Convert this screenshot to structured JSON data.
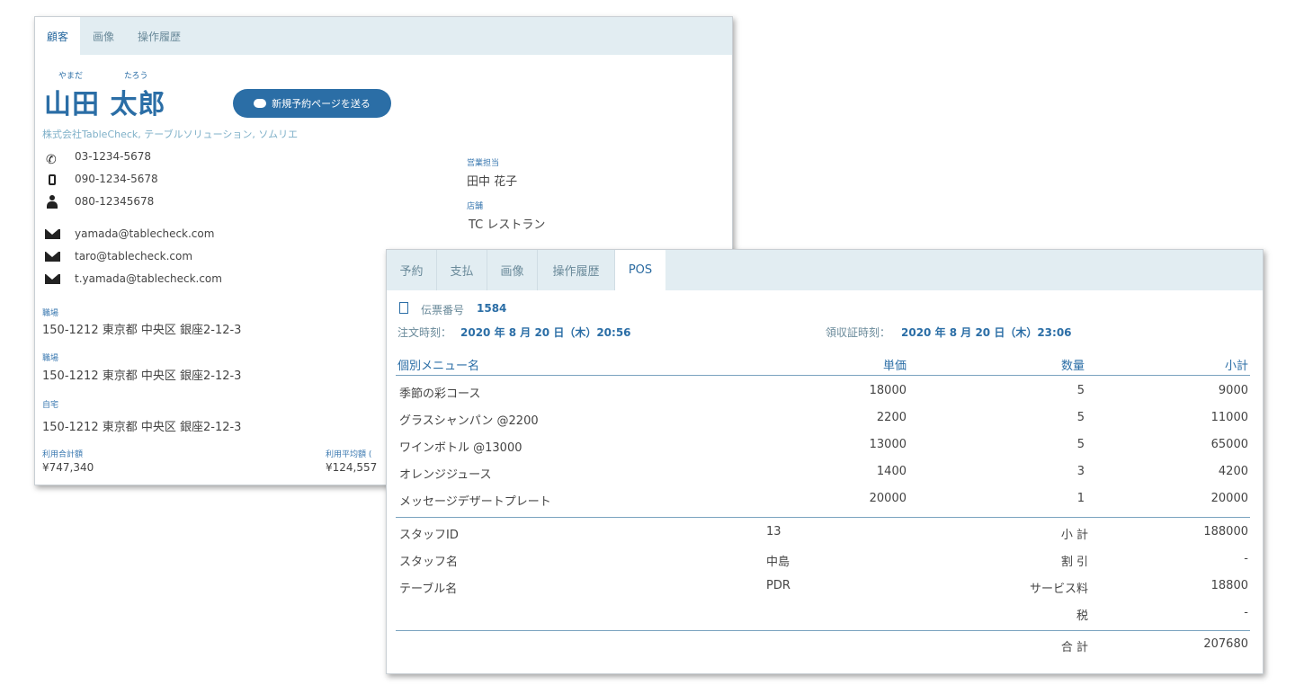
{
  "customer_card": {
    "tabs": [
      "顧客",
      "画像",
      "操作履歴"
    ],
    "furigana_last": "やまだ",
    "furigana_first": "たろう",
    "name": "山田 太郎",
    "send_button_label": "新規予約ページを送る",
    "company": "株式会社TableCheck, テーブルソリューション, ソムリエ",
    "phones": [
      "03-1234-5678",
      "090-1234-5678",
      "080-12345678"
    ],
    "phone_icons": [
      "phone-icon",
      "mobile-icon",
      "person-icon"
    ],
    "emails": [
      "yamada@tablecheck.com",
      "taro@tablecheck.com",
      "t.yamada@tablecheck.com"
    ],
    "sales_rep_label": "営業担当",
    "sales_rep": "田中 花子",
    "store_label": "店舗",
    "store": "TC レストラン",
    "addresses": [
      {
        "label": "職場",
        "value": "150-1212 東京都 中央区 銀座2-12-3"
      },
      {
        "label": "職場",
        "value": "150-1212 東京都 中央区 銀座2-12-3"
      },
      {
        "label": "自宅",
        "value": "150-1212 東京都 中央区 銀座2-12-3"
      }
    ],
    "total_usage_label": "利用合計額",
    "total_usage": "¥747,340",
    "avg_usage_label": "利用平均額 (",
    "avg_usage": "¥124,557"
  },
  "pos_card": {
    "tabs": [
      "予約",
      "支払",
      "画像",
      "操作履歴",
      "POS"
    ],
    "active_tab": "POS",
    "slip_label": "伝票番号",
    "slip_number": "1584",
    "order_time_label": "注文時刻：",
    "order_time": "2020 年 8 月 20 日（木）20:56",
    "receipt_time_label": "領収証時刻：",
    "receipt_time": "2020 年 8 月 20 日（木）23:06",
    "columns": [
      "個別メニュー名",
      "単価",
      "数量",
      "小計"
    ],
    "items": [
      {
        "name": "季節の彩コース",
        "price": "18000",
        "qty": "5",
        "subtotal": "9000"
      },
      {
        "name": "グラスシャンパン @2200",
        "price": "2200",
        "qty": "5",
        "subtotal": "11000"
      },
      {
        "name": "ワインボトル @13000",
        "price": "13000",
        "qty": "5",
        "subtotal": "65000"
      },
      {
        "name": "オレンジジュース",
        "price": "1400",
        "qty": "3",
        "subtotal": "4200"
      },
      {
        "name": "メッセージデザートプレート",
        "price": "20000",
        "qty": "1",
        "subtotal": "20000"
      }
    ],
    "staff_id_label": "スタッフID",
    "staff_id": "13",
    "staff_name_label": "スタッフ名",
    "staff_name": "中島",
    "table_label": "テーブル名",
    "table_name": "PDR",
    "summary": [
      {
        "label": "小 計",
        "value": "188000"
      },
      {
        "label": "割 引",
        "value": "-"
      },
      {
        "label": "サービス料",
        "value": "18800"
      },
      {
        "label": "税",
        "value": "-"
      }
    ],
    "total_label": "合 計",
    "total_value": "207680"
  }
}
